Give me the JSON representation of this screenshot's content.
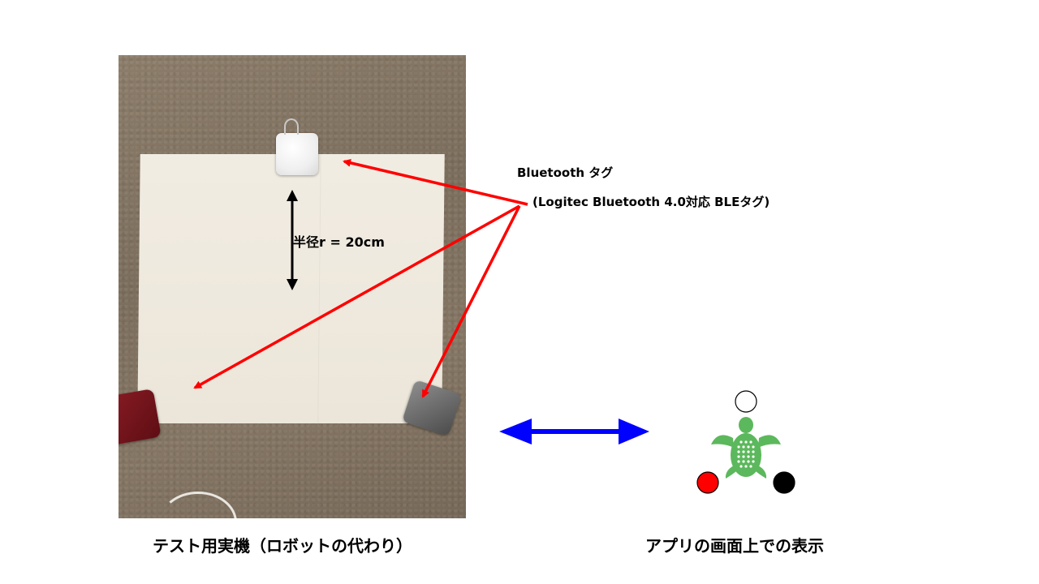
{
  "labels": {
    "radius": "半径r = 20cm",
    "tag_title": "Bluetooth タグ",
    "tag_model": "(Logitec Bluetooth 4.0対応 BLEタグ)",
    "caption_left": "テスト用実機（ロボットの代わり）",
    "caption_right": "アプリの画面上での表示"
  },
  "colors": {
    "pointer_arrow": "#ff0000",
    "radius_arrow": "#000000",
    "double_arrow": "#0000ff",
    "turtle": "#5cb85c",
    "dot_top": "#ffffff",
    "dot_left": "#ff0000",
    "dot_right": "#000000"
  },
  "icons": {
    "robot_marker": "turtle-icon"
  }
}
